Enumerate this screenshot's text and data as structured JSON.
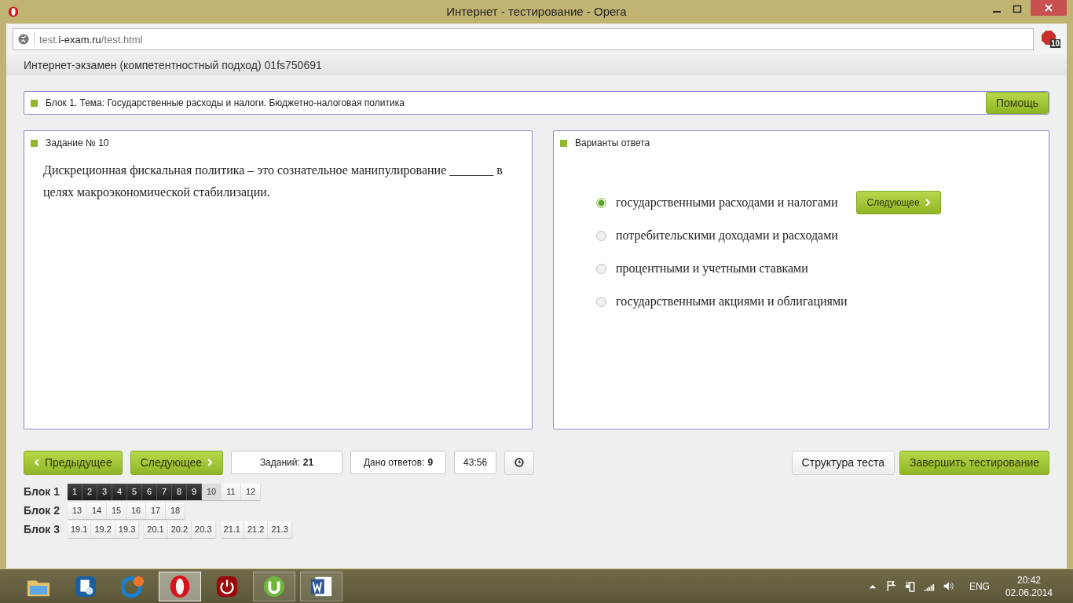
{
  "window": {
    "title": "Интернет - тестирование - Opera"
  },
  "address_bar": {
    "prefix": "test.",
    "domain": "i-exam.ru",
    "path": "/test.html",
    "adblock_count": "10"
  },
  "page_header": "Интернет-экзамен (компетентностный подход) 01fs750691",
  "topic": {
    "text": "Блок 1. Тема: Государственные расходы и налоги. Бюджетно-налоговая политика",
    "help_button": "Помощь"
  },
  "task": {
    "title": "Задание № 10",
    "question": "Дискреционная фискальная политика – это сознательное манипулирование _______ в целях макроэкономической стабилизации."
  },
  "answers": {
    "title": "Варианты ответа",
    "next_button": "Следующее",
    "options": [
      {
        "label": "государственными расходами и налогами",
        "selected": true
      },
      {
        "label": "потребительскими доходами и расходами",
        "selected": false
      },
      {
        "label": "процентными и учетными ставками",
        "selected": false
      },
      {
        "label": "государственными акциями и облигациями",
        "selected": false
      }
    ]
  },
  "nav": {
    "prev_button": "Предыдущее",
    "next_button": "Следующее",
    "tasks_label": "Заданий:",
    "tasks_value": "21",
    "answered_label": "Дано ответов:",
    "answered_value": "9",
    "timer": "43:56",
    "structure_button": "Структура теста",
    "finish_button": "Завершить тестирование"
  },
  "blocks": [
    {
      "label": "Блок 1",
      "groups": [
        [
          {
            "label": "1",
            "answered": true,
            "selected": false
          },
          {
            "label": "2",
            "answered": true,
            "selected": false
          },
          {
            "label": "3",
            "answered": true,
            "selected": false
          },
          {
            "label": "4",
            "answered": true,
            "selected": false
          },
          {
            "label": "5",
            "answered": true,
            "selected": false
          },
          {
            "label": "6",
            "answered": true,
            "selected": false
          },
          {
            "label": "7",
            "answered": true,
            "selected": false
          },
          {
            "label": "8",
            "answered": true,
            "selected": false
          },
          {
            "label": "9",
            "answered": true,
            "selected": false
          },
          {
            "label": "10",
            "answered": false,
            "selected": true
          },
          {
            "label": "11",
            "answered": false,
            "selected": false
          },
          {
            "label": "12",
            "answered": false,
            "selected": false
          }
        ]
      ]
    },
    {
      "label": "Блок 2",
      "groups": [
        [
          {
            "label": "13",
            "answered": false,
            "selected": false
          },
          {
            "label": "14",
            "answered": false,
            "selected": false
          },
          {
            "label": "15",
            "answered": false,
            "selected": false
          },
          {
            "label": "16",
            "answered": false,
            "selected": false
          },
          {
            "label": "17",
            "answered": false,
            "selected": false
          },
          {
            "label": "18",
            "answered": false,
            "selected": false
          }
        ]
      ]
    },
    {
      "label": "Блок 3",
      "groups": [
        [
          {
            "label": "19.1",
            "answered": false,
            "selected": false
          },
          {
            "label": "19.2",
            "answered": false,
            "selected": false
          },
          {
            "label": "19.3",
            "answered": false,
            "selected": false
          }
        ],
        [
          {
            "label": "20.1",
            "answered": false,
            "selected": false
          },
          {
            "label": "20.2",
            "answered": false,
            "selected": false
          },
          {
            "label": "20.3",
            "answered": false,
            "selected": false
          }
        ],
        [
          {
            "label": "21.1",
            "answered": false,
            "selected": false
          },
          {
            "label": "21.2",
            "answered": false,
            "selected": false
          },
          {
            "label": "21.3",
            "answered": false,
            "selected": false
          }
        ]
      ]
    }
  ],
  "taskbar": {
    "apps": [
      {
        "kind": "folder",
        "selected": false,
        "running": false
      },
      {
        "kind": "settings",
        "selected": false,
        "running": false
      },
      {
        "kind": "chat",
        "selected": false,
        "running": false
      },
      {
        "kind": "opera",
        "selected": true,
        "running": true
      },
      {
        "kind": "power",
        "selected": false,
        "running": false
      },
      {
        "kind": "torrent",
        "selected": false,
        "running": true
      },
      {
        "kind": "word",
        "selected": false,
        "running": true
      }
    ],
    "language": "ENG",
    "time": "20:42",
    "date": "02.06.2014"
  }
}
